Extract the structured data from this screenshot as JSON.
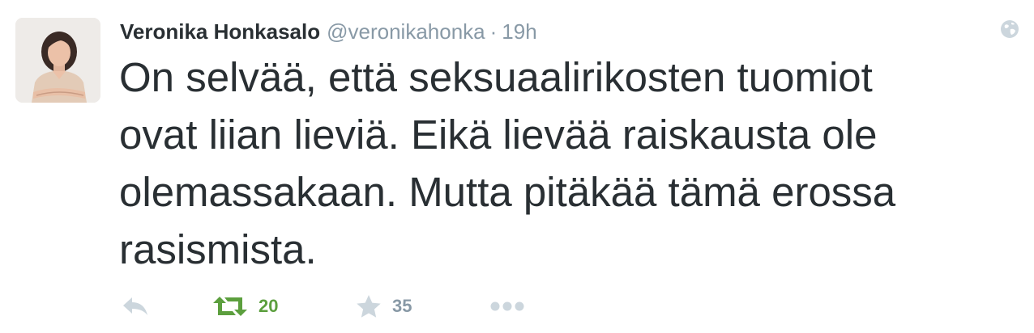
{
  "tweet": {
    "author_name": "Veronika Honkasalo",
    "handle": "@veronikahonka",
    "separator": "·",
    "time": "19h",
    "text_lines": [
      "On selvää, että seksuaalirikosten tuomiot",
      "ovat liian lieviä. Eikä lievää raiskausta ole",
      "olemassakaan. Mutta pitäkää tämä erossa",
      "rasismista."
    ]
  },
  "actions": {
    "reply_icon": "reply-icon",
    "retweet_icon": "retweet-icon",
    "retweet_count": "20",
    "favorite_icon": "star-icon",
    "favorite_count": "35",
    "more_icon": "more-dots-icon"
  },
  "colors": {
    "text": "#292f33",
    "muted": "#8899a6",
    "icon": "#ccd6dd",
    "retweet_active": "#5c9f3e"
  }
}
